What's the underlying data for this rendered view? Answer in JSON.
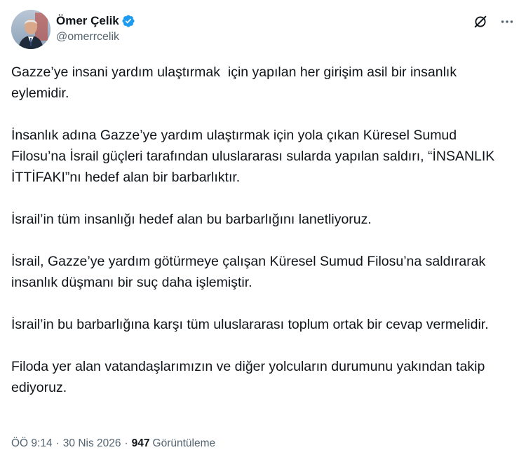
{
  "author": {
    "display_name": "Ömer Çelik",
    "handle": "@omerrcelik",
    "verified": true,
    "verified_color": "#1d9bf0"
  },
  "icons": {
    "verified": "verified-badge-icon",
    "grok": "grok-icon",
    "more": "more-options-icon"
  },
  "tweet": {
    "paragraphs": [
      "Gazze’ye insani yardım ulaştırmak  için yapılan her girişim asil bir insanlık eylemidir.",
      "İnsanlık adına Gazze’ye yardım ulaştırmak için yola çıkan Küresel Sumud Filosu’na İsrail güçleri tarafından uluslararası sularda yapılan saldırı, “İNSANLIK İTTİFAKI”nı hedef alan bir barbarlıktır.",
      "İsrail’in tüm insanlığı hedef alan bu barbarlığını lanetliyoruz.",
      "İsrail, Gazze’ye yardım götürmeye çalışan Küresel Sumud Filosu’na saldırarak insanlık düşmanı bir suç daha işlemiştir.",
      "İsrail’in bu barbarlığına karşı tüm uluslararası toplum ortak bir cevap vermelidir.",
      "Filoda yer alan vatandaşlarımızın ve diğer yolcuların durumunu yakından takip ediyoruz."
    ]
  },
  "meta": {
    "time": "ÖÖ 9:14",
    "separator": "·",
    "date": "30 Nis 2026",
    "views_count": "947",
    "views_label": "Görüntüleme"
  },
  "colors": {
    "text": "#0f1419",
    "secondary": "#536471",
    "accent": "#1d9bf0"
  }
}
